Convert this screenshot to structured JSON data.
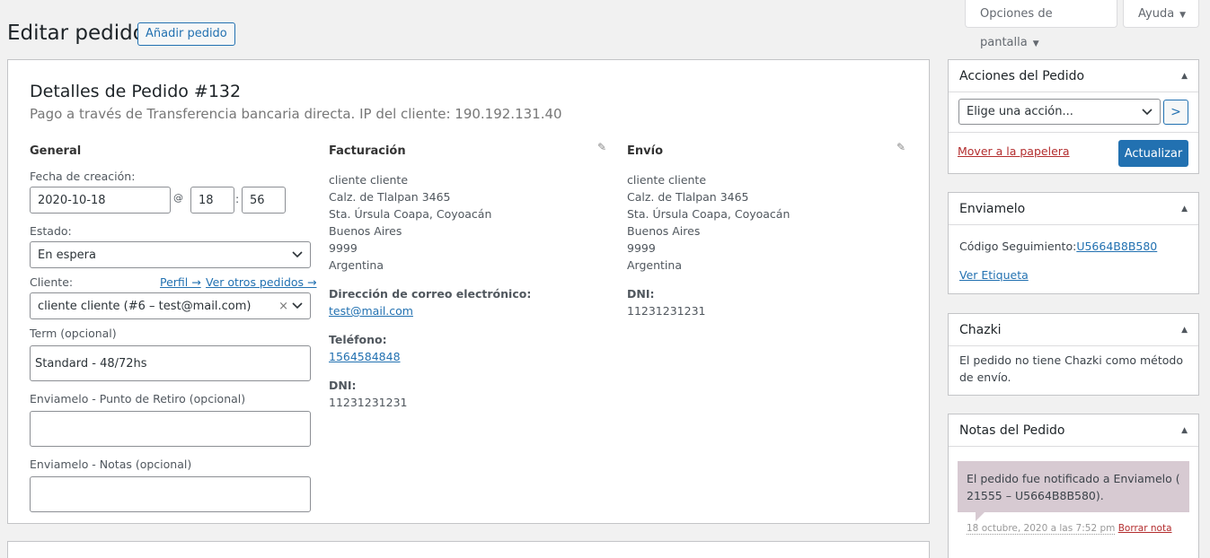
{
  "header": {
    "title": "Editar pedido",
    "add_button": "Añadir pedido",
    "screen_options": "Opciones de pantalla",
    "help": "Ayuda"
  },
  "order": {
    "title": "Detalles de Pedido #132",
    "subtitle": "Pago a través de Transferencia bancaria directa. IP del cliente: 190.192.131.40"
  },
  "general": {
    "heading": "General",
    "date_label": "Fecha de creación:",
    "date_value": "2020-10-18",
    "at": "@",
    "hour": "18",
    "colon": ":",
    "minute": "56",
    "status_label": "Estado:",
    "status_value": "En espera",
    "customer_label": "Cliente:",
    "profile_link": "Perfil →",
    "other_orders_link": "Ver otros pedidos →",
    "customer_value": "cliente cliente (#6 – test@mail.com)",
    "clear": "×",
    "term_label": "Term (opcional)",
    "term_value": "Standard - 48/72hs",
    "pickup_label": "Enviamelo - Punto de Retiro (opcional)",
    "pickup_value": "",
    "notes_label": "Enviamelo - Notas (opcional)",
    "notes_value": ""
  },
  "billing": {
    "heading": "Facturación",
    "address": [
      "cliente cliente",
      "Calz. de Tlalpan 3465",
      "Sta. Úrsula Coapa, Coyoacán",
      "Buenos Aires",
      "9999",
      "Argentina"
    ],
    "email_label": "Dirección de correo electrónico:",
    "email": "test@mail.com",
    "phone_label": "Teléfono:",
    "phone": "1564584848",
    "dni_label": "DNI:",
    "dni": "11231231231"
  },
  "shipping": {
    "heading": "Envío",
    "address": [
      "cliente cliente",
      "Calz. de Tlalpan 3465",
      "Sta. Úrsula Coapa, Coyoacán",
      "Buenos Aires",
      "9999",
      "Argentina"
    ],
    "dni_label": "DNI:",
    "dni": "11231231231"
  },
  "actions_box": {
    "title": "Acciones del Pedido",
    "select_placeholder": "Elige una acción...",
    "go": ">",
    "trash": "Mover a la papelera",
    "update": "Actualizar"
  },
  "enviamelo_box": {
    "title": "Enviamelo",
    "tracking_label": "Código Seguimiento:",
    "tracking_code": "U5664B8B580",
    "label_link": "Ver Etiqueta"
  },
  "chazki_box": {
    "title": "Chazki",
    "text": "El pedido no tiene Chazki como método de envío."
  },
  "notes_box": {
    "title": "Notas del Pedido",
    "note_text": "El pedido fue notificado a Enviamelo ( 21555 – U5664B8B580).",
    "note_date": "18 octubre, 2020 a las 7:52 pm",
    "delete": "Borrar nota"
  }
}
